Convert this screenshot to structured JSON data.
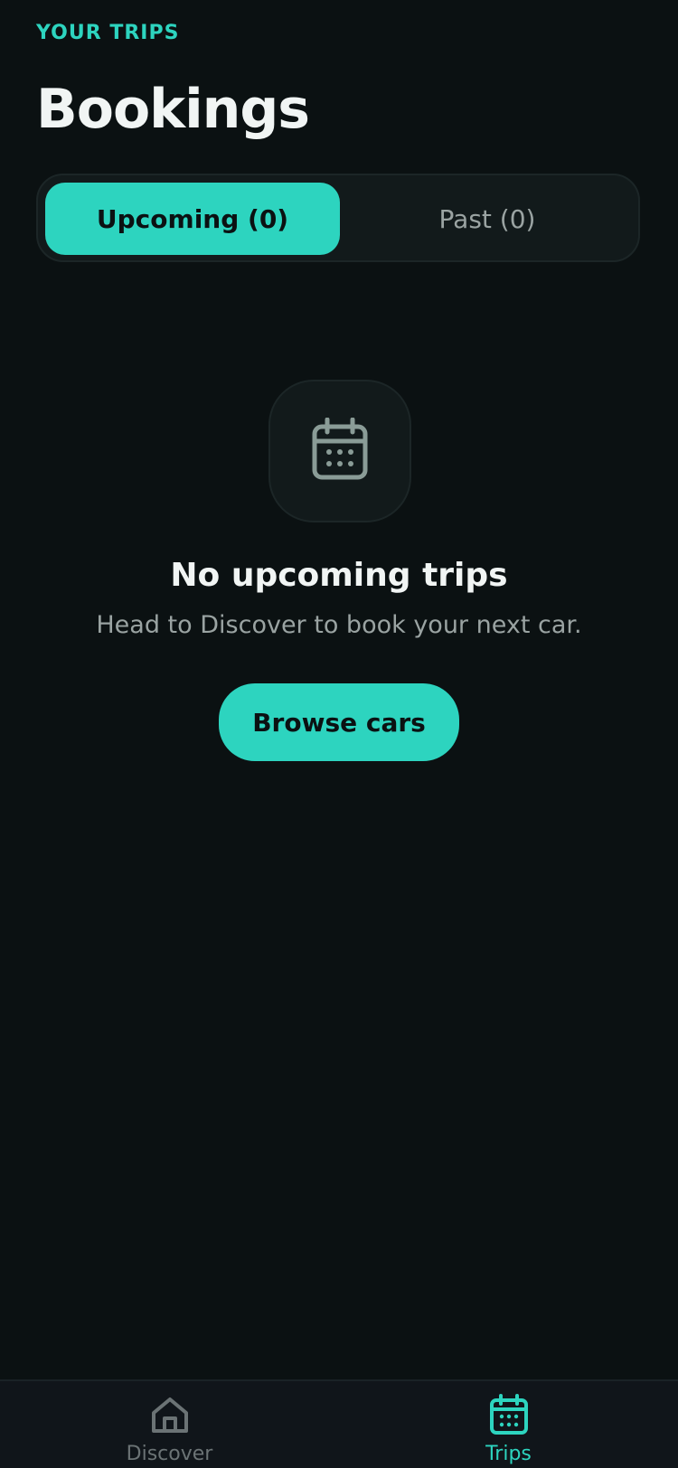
{
  "header": {
    "eyebrow": "YOUR TRIPS",
    "title": "Bookings"
  },
  "segments": [
    {
      "label": "Upcoming (0)",
      "active": true
    },
    {
      "label": "Past (0)",
      "active": false
    }
  ],
  "empty_state": {
    "icon": "calendar-icon",
    "title": "No upcoming trips",
    "subtitle": "Head to Discover to book your next car.",
    "cta_label": "Browse cars"
  },
  "tabbar": {
    "items": [
      {
        "label": "Discover",
        "icon": "home-icon",
        "active": false
      },
      {
        "label": "Trips",
        "icon": "calendar-icon",
        "active": true
      }
    ]
  },
  "colors": {
    "accent": "#2dd4bf",
    "background": "#0b1112",
    "muted_text": "#9aa3a2"
  }
}
